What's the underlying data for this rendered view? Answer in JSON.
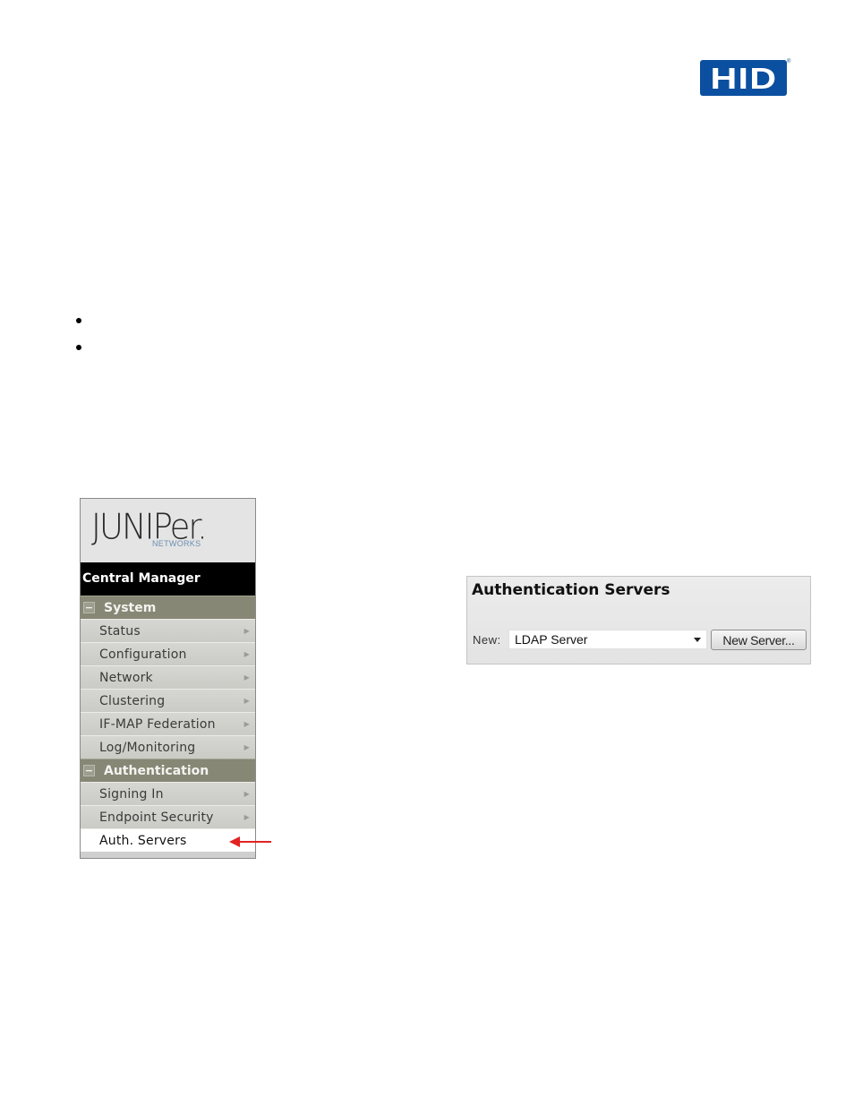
{
  "header": {
    "logo_text": "HID",
    "logo_registered": "®",
    "brand_color": "#0b4fa0"
  },
  "bullets": [
    "",
    ""
  ],
  "nav_panel": {
    "brand": {
      "name": "JUNIPer.",
      "sub": "NETWORKS"
    },
    "title": "Central Manager",
    "sections": [
      {
        "label": "System",
        "collapse_glyph": "−",
        "items": [
          {
            "label": "Status",
            "chevron": "▶"
          },
          {
            "label": "Configuration",
            "chevron": "▶"
          },
          {
            "label": "Network",
            "chevron": "▶"
          },
          {
            "label": "Clustering",
            "chevron": "▶"
          },
          {
            "label": "IF-MAP Federation",
            "chevron": "▶"
          },
          {
            "label": "Log/Monitoring",
            "chevron": "▶"
          }
        ]
      },
      {
        "label": "Authentication",
        "collapse_glyph": "−",
        "items": [
          {
            "label": "Signing In",
            "chevron": "▶"
          },
          {
            "label": "Endpoint Security",
            "chevron": "▶"
          },
          {
            "label": "Auth. Servers",
            "chevron": "",
            "active": true
          }
        ]
      }
    ],
    "pointer_color": "#e32222"
  },
  "auth_panel": {
    "title": "Authentication Servers",
    "new_label": "New:",
    "select_value": "LDAP Server",
    "button_label": "New Server..."
  }
}
